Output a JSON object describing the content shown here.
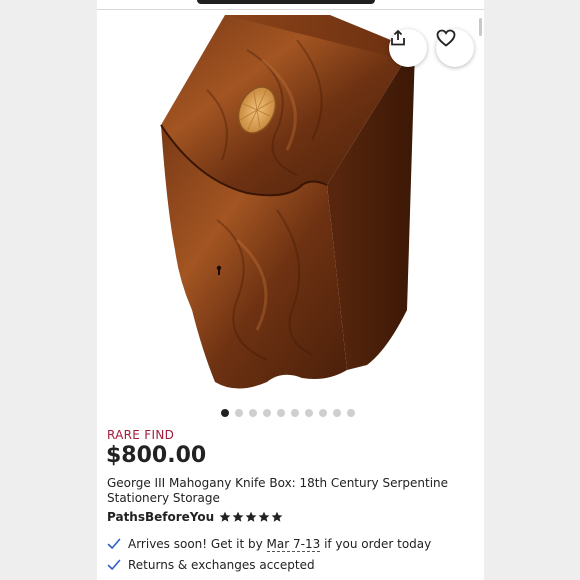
{
  "carousel": {
    "total": 10,
    "active_index": 0
  },
  "listing": {
    "badge": "RARE FIND",
    "price": "$800.00",
    "title": "George III Mahogany Knife Box: 18th Century Serpentine Stationery Storage",
    "shop_name": "PathsBeforeYou",
    "rating_stars": 5
  },
  "features": {
    "arrival_prefix": "Arrives soon! Get it by",
    "arrival_dates": "Mar 7-13",
    "arrival_suffix": "if you order today",
    "returns": "Returns & exchanges accepted"
  },
  "icons": {
    "share": "share-icon",
    "favorite": "heart-outline-icon",
    "check": "checkmark-icon",
    "star": "star-filled-icon"
  },
  "colors": {
    "badge": "#a61a3b",
    "check": "#2e5fc9",
    "star": "#222222"
  }
}
